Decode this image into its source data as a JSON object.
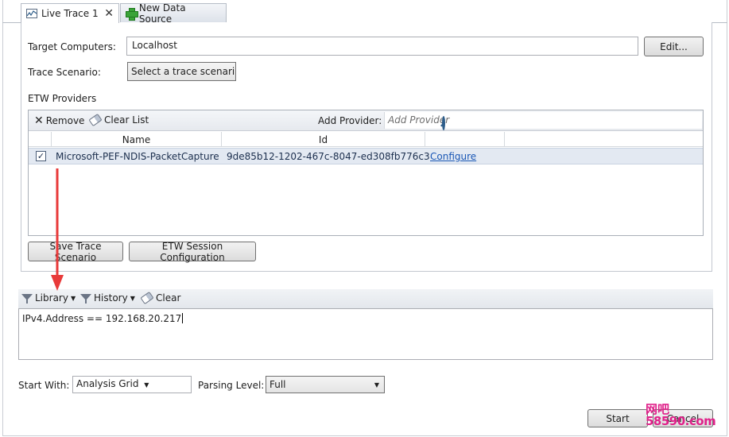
{
  "tabs": [
    {
      "label": "Live Trace 1",
      "close": "✕"
    },
    {
      "label": "New Data Source"
    }
  ],
  "target_computers": {
    "label": "Target Computers:",
    "value": "Localhost",
    "edit_button": "Edit..."
  },
  "trace_scenario": {
    "label": "Trace Scenario:",
    "value": "Select a trace scenari"
  },
  "etw_providers": {
    "label": "ETW Providers",
    "toolbar": {
      "remove": "Remove",
      "clear_list": "Clear List",
      "add_provider_label": "Add Provider:",
      "add_provider_placeholder": "Add Provider"
    },
    "columns": [
      "Name",
      "Id"
    ],
    "rows": [
      {
        "checked": true,
        "name": "Microsoft-PEF-NDIS-PacketCapture",
        "id": "9de85b12-1202-467c-8047-ed308fb776c3",
        "action": "Configure"
      }
    ]
  },
  "panel_buttons": {
    "save_trace_scenario": "Save Trace Scenario",
    "etw_session_configuration": "ETW Session Configuration"
  },
  "filter_toolbar": {
    "library": "Library",
    "history": "History",
    "clear": "Clear"
  },
  "filter_text": "IPv4.Address == 192.168.20.217",
  "start_with": {
    "label": "Start With:",
    "value": "Analysis Grid"
  },
  "parsing_level": {
    "label": "Parsing Level:",
    "value": "Full"
  },
  "footer_buttons": {
    "start": "Start",
    "cancel": "Cancel"
  },
  "watermark": {
    "line1": "网吧",
    "line2": "58590.com"
  },
  "colors": {
    "annotation_arrow": "#e83a3a",
    "link": "#1a57b5",
    "selected_row": "#e3e9f2"
  }
}
